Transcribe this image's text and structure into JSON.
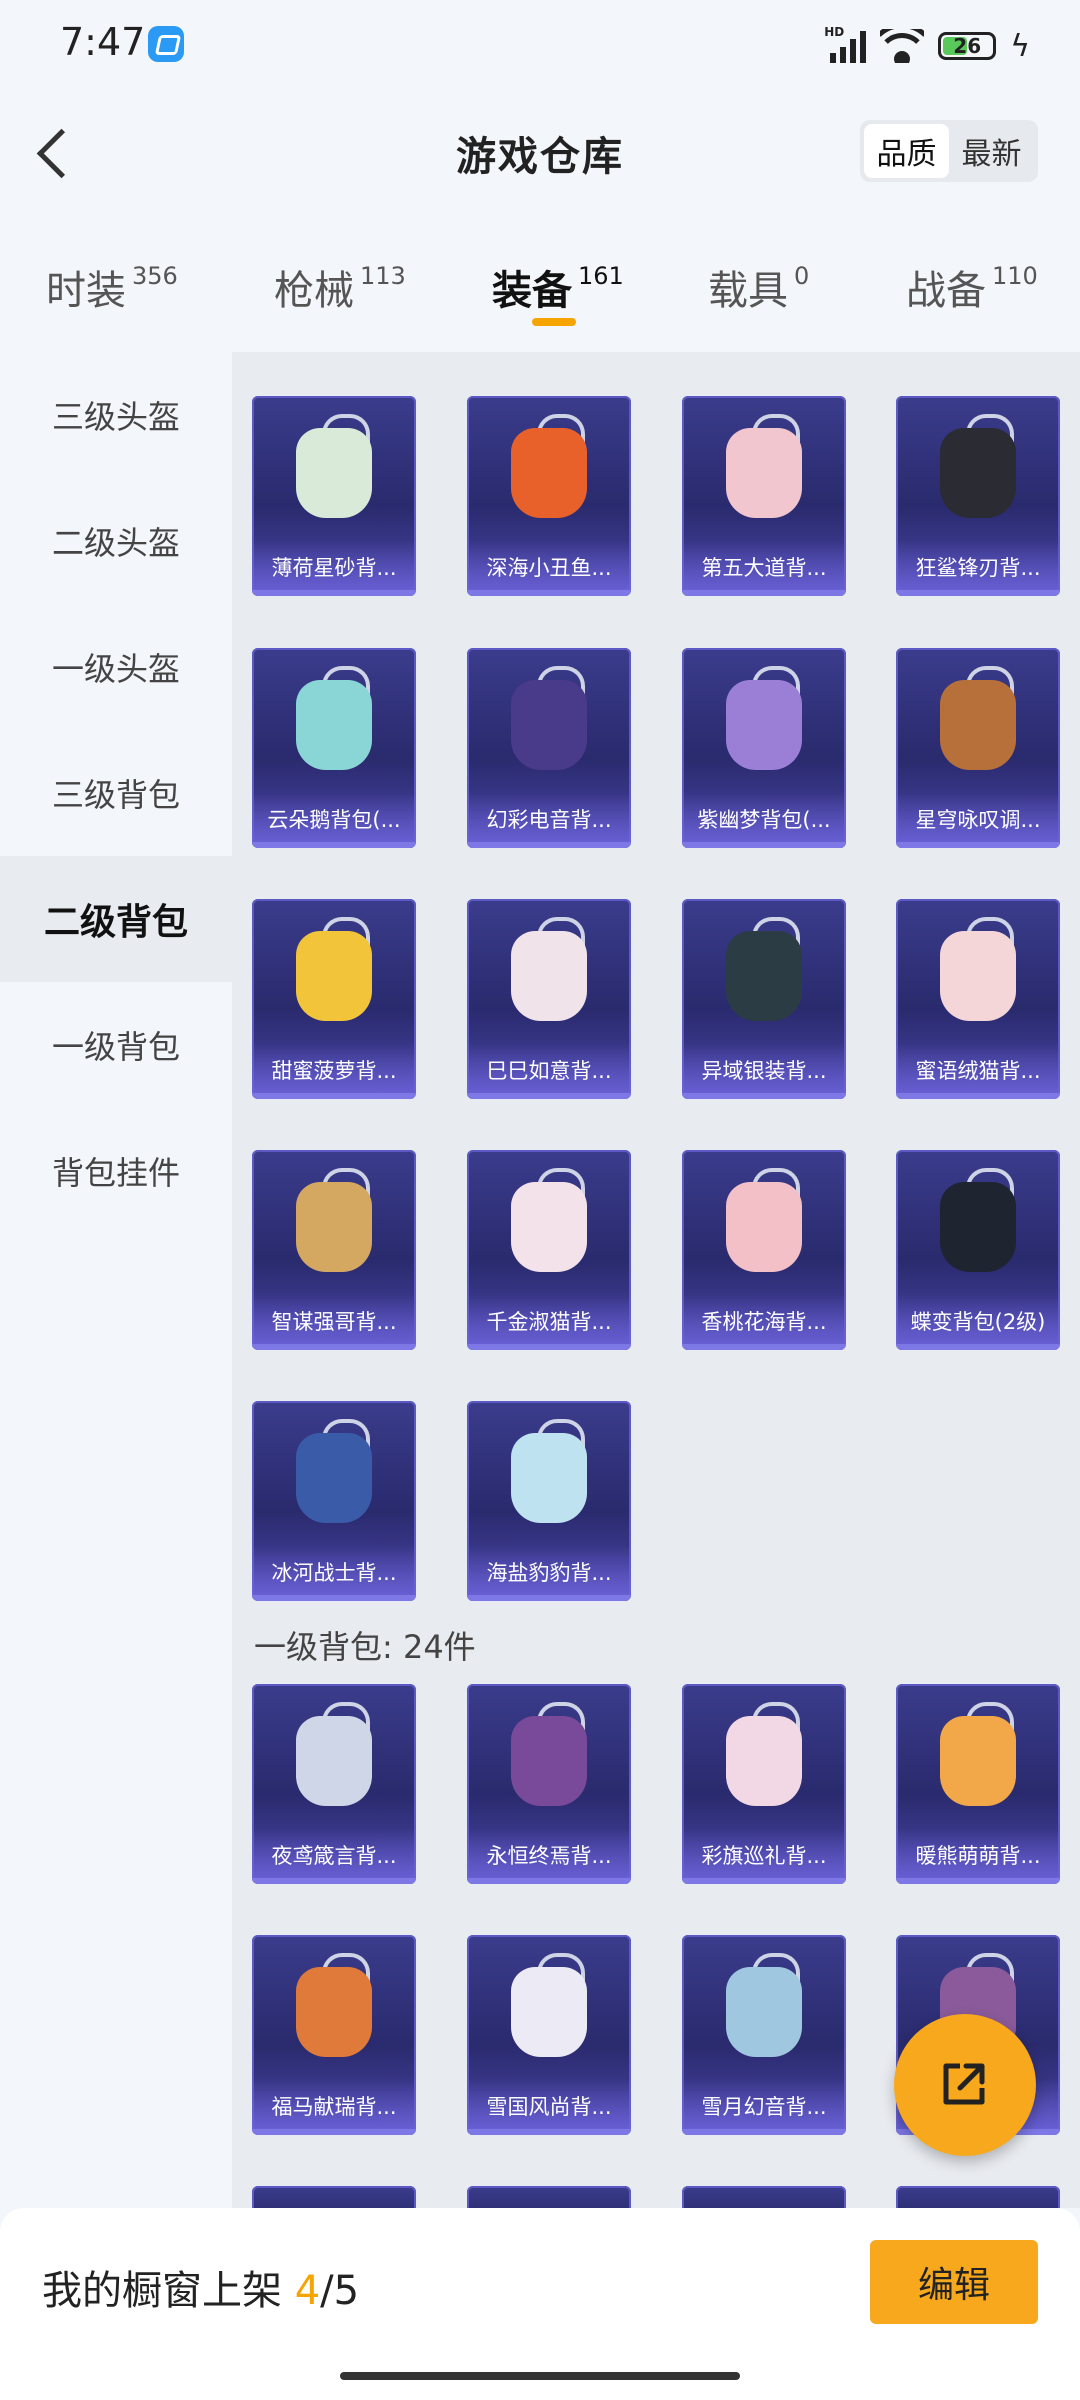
{
  "status": {
    "time": "7:47",
    "battery": "26",
    "network": "HD"
  },
  "header": {
    "title": "游戏仓库",
    "sort_options": [
      "品质",
      "最新"
    ],
    "sort_active": "品质"
  },
  "tabs": [
    {
      "label": "时装",
      "count": "356"
    },
    {
      "label": "枪械",
      "count": "113"
    },
    {
      "label": "装备",
      "count": "161"
    },
    {
      "label": "载具",
      "count": "0"
    },
    {
      "label": "战备",
      "count": "110"
    }
  ],
  "sidebar": [
    "三级头盔",
    "二级头盔",
    "一级头盔",
    "三级背包",
    "二级背包",
    "一级背包",
    "背包挂件"
  ],
  "sidebar_active": "二级背包",
  "level2_items": [
    "薄荷星砂背...",
    "深海小丑鱼...",
    "第五大道背...",
    "狂鲨锋刃背...",
    "云朵鹅背包(...",
    "幻彩电音背...",
    "紫幽梦背包(...",
    "星穹咏叹调...",
    "甜蜜菠萝背...",
    "巳巳如意背...",
    "异域银装背...",
    "蜜语绒猫背...",
    "智谋强哥背...",
    "千金淑猫背...",
    "香桃花海背...",
    "蝶变背包(2级)",
    "冰河战士背...",
    "海盐豹豹背..."
  ],
  "level1_section": "一级背包: 24件",
  "level1_items": [
    "夜鸢箴言背...",
    "永恒终焉背...",
    "彩旗巡礼背...",
    "暖熊萌萌背...",
    "福马献瑞背...",
    "雪国风尚背...",
    "雪月幻音背...",
    ""
  ],
  "bottom": {
    "label": "我的橱窗上架",
    "current": "4",
    "total": "/5",
    "edit": "编辑"
  },
  "colors": {
    "accent": "#f7a81c",
    "card": "#2a2a6e"
  },
  "icons": [
    "back-icon",
    "share-icon",
    "wifi-icon",
    "signal-icon",
    "battery-icon"
  ]
}
